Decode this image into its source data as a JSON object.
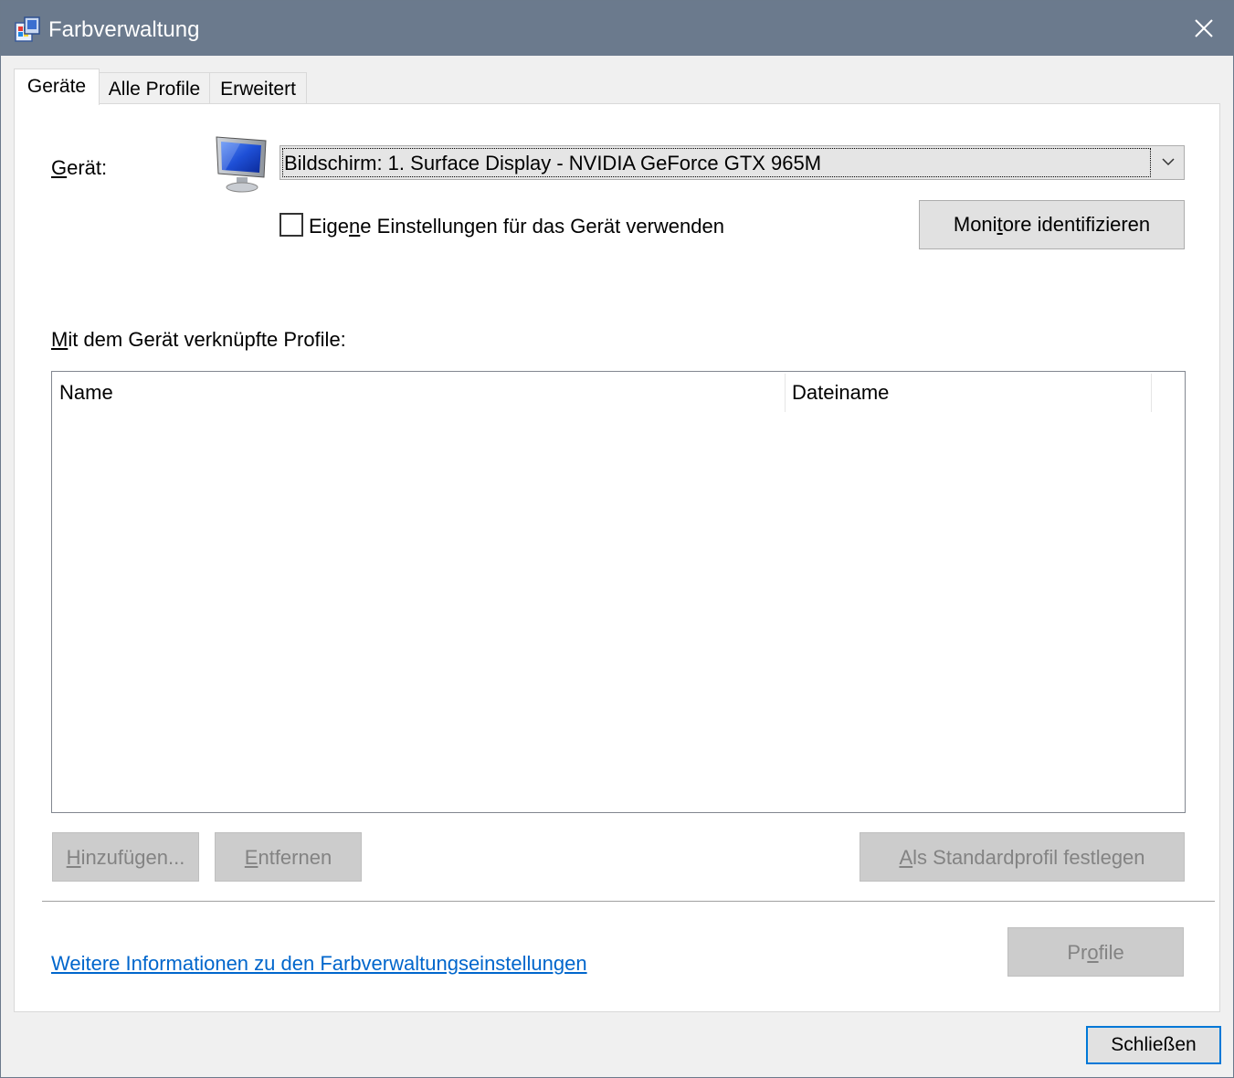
{
  "window": {
    "title": "Farbverwaltung"
  },
  "tabs": [
    {
      "label": "Geräte",
      "active": true
    },
    {
      "label": "Alle Profile",
      "active": false
    },
    {
      "label": "Erweitert",
      "active": false
    }
  ],
  "device": {
    "label_accel": "G",
    "label_rest": "erät:",
    "selected": "Bildschirm: 1. Surface Display - NVIDIA GeForce GTX 965M",
    "own_settings_pre": "Eige",
    "own_settings_accel": "n",
    "own_settings_post": "e Einstellungen für das Gerät verwenden",
    "own_settings_checked": false,
    "identify_pre": "Moni",
    "identify_accel": "t",
    "identify_post": "ore identifizieren"
  },
  "profiles": {
    "label_accel": "M",
    "label_rest": "it dem Gerät verknüpfte Profile:",
    "columns": [
      "Name",
      "Dateiname"
    ],
    "rows": []
  },
  "actions": {
    "add_accel": "H",
    "add_rest": "inzufügen...",
    "remove_accel": "E",
    "remove_rest": "ntfernen",
    "default_accel": "A",
    "default_rest": "ls Standardprofil festlegen",
    "profile_pre": "Pr",
    "profile_accel": "o",
    "profile_post": "file"
  },
  "footer": {
    "info_link": "Weitere Informationen zu den Farbverwaltungseinstellungen",
    "close_label": "Schließen"
  },
  "colors": {
    "titlebar": "#6b7a8d",
    "link": "#0066cc",
    "default_button_border": "#0078d7",
    "disabled_text": "#838383"
  },
  "icons": {
    "app": "color-management-icon",
    "device": "monitor-icon",
    "close": "close-icon",
    "dropdown": "chevron-down-icon"
  }
}
